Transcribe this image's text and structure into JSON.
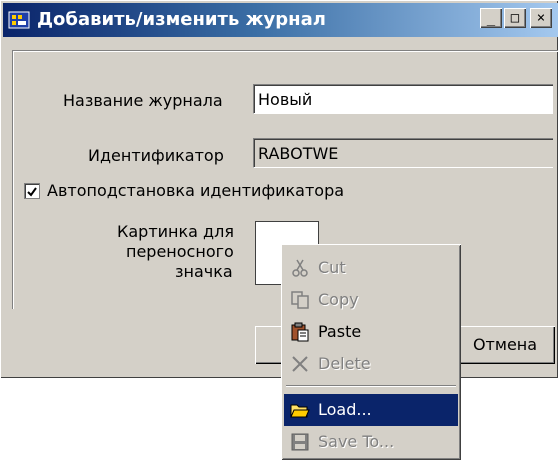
{
  "window": {
    "title": "Добавить/изменить журнал",
    "min_glyph": "_",
    "max_glyph": "□",
    "close_glyph": "×"
  },
  "form": {
    "name_label": "Название журнала",
    "name_value": "Новый",
    "id_label": "Идентификатор",
    "id_value": "RABOTWE",
    "auto_checkbox_label": "Автоподстановка идентификатора",
    "auto_checked": true,
    "picture_label_1": "Картинка для",
    "picture_label_2": "переносного",
    "picture_label_3": "значка"
  },
  "buttons": {
    "cancel": "Отмена"
  },
  "context_menu": {
    "items": [
      {
        "label": "Cut",
        "icon": "scissors-icon",
        "enabled": false
      },
      {
        "label": "Copy",
        "icon": "copy-icon",
        "enabled": false
      },
      {
        "label": "Paste",
        "icon": "paste-icon",
        "enabled": true
      },
      {
        "label": "Delete",
        "icon": "delete-x-icon",
        "enabled": false
      },
      {
        "label": "Load...",
        "icon": "open-folder-icon",
        "enabled": true,
        "highlighted": true
      },
      {
        "label": "Save To...",
        "icon": "floppy-disk-icon",
        "enabled": false
      }
    ]
  },
  "colors": {
    "face": "#d4d0c8",
    "title_start": "#0a246a",
    "title_end": "#a6caf0",
    "highlight": "#0a246a",
    "disabled_text": "#808080"
  }
}
